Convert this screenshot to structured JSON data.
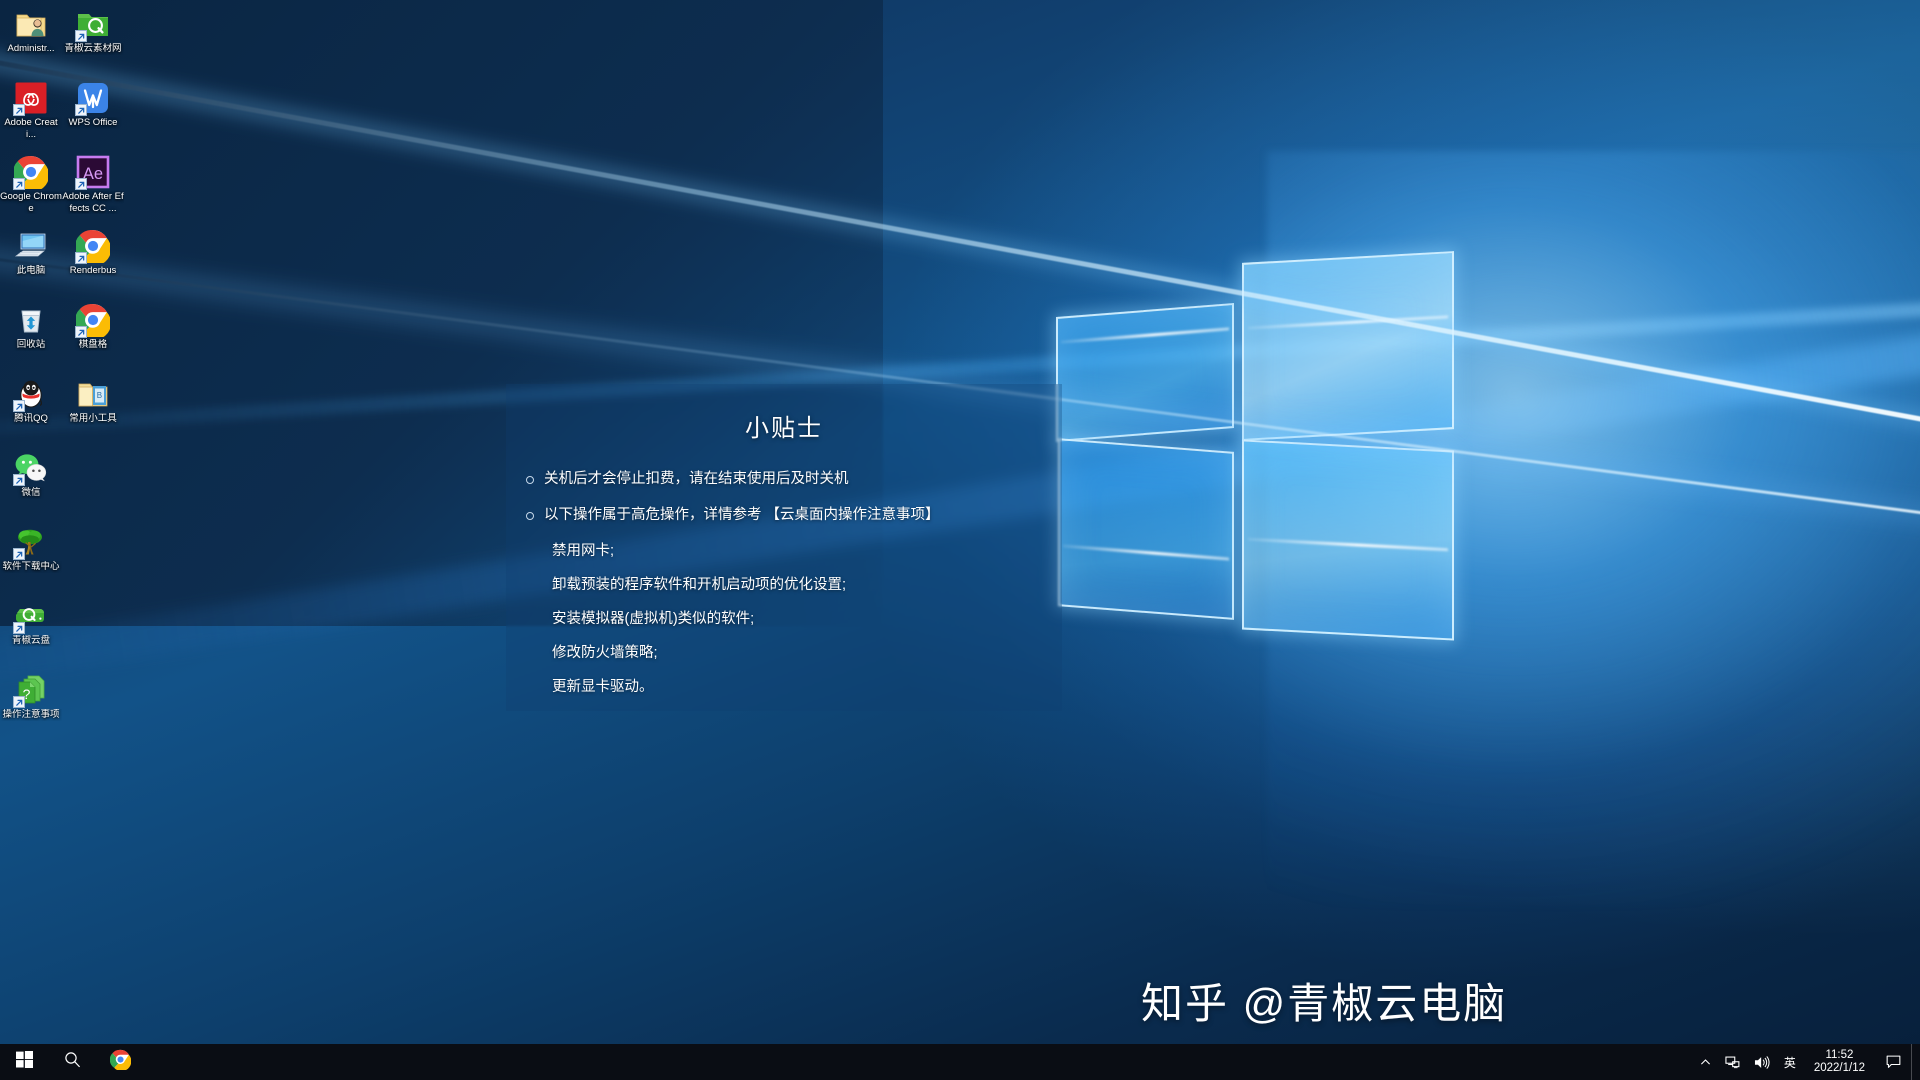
{
  "desktop": {
    "icons": [
      {
        "label": "Administr...",
        "icon": "user-folder-icon",
        "shortcut": false
      },
      {
        "label": "青椒云素材网",
        "icon": "green-folder-q-icon",
        "shortcut": true
      },
      {
        "label": "Adobe Creati...",
        "icon": "adobe-creative-cloud-icon",
        "shortcut": true
      },
      {
        "label": "WPS Office",
        "icon": "wps-office-icon",
        "shortcut": true
      },
      {
        "label": "Google Chrome",
        "icon": "chrome-icon",
        "shortcut": true
      },
      {
        "label": "Adobe After Effects CC ...",
        "icon": "after-effects-icon",
        "shortcut": true
      },
      {
        "label": "此电脑",
        "icon": "this-pc-icon",
        "shortcut": false
      },
      {
        "label": "Renderbus",
        "icon": "chrome-icon",
        "shortcut": true
      },
      {
        "label": "回收站",
        "icon": "recycle-bin-icon",
        "shortcut": false
      },
      {
        "label": "棋盘格",
        "icon": "chrome-icon",
        "shortcut": true
      },
      {
        "label": "腾讯QQ",
        "icon": "tencent-qq-icon",
        "shortcut": true
      },
      {
        "label": "常用小工具",
        "icon": "tools-folder-icon",
        "shortcut": false
      },
      {
        "label": "微信",
        "icon": "wechat-icon",
        "shortcut": true
      },
      {
        "label": "",
        "icon": "empty-slot",
        "shortcut": false
      },
      {
        "label": "软件下载中心",
        "icon": "tree-icon",
        "shortcut": true
      },
      {
        "label": "",
        "icon": "empty-slot",
        "shortcut": false
      },
      {
        "label": "青椒云盘",
        "icon": "green-drive-q-icon",
        "shortcut": true
      },
      {
        "label": "",
        "icon": "empty-slot",
        "shortcut": false
      },
      {
        "label": "操作注意事项",
        "icon": "green-help-doc-icon",
        "shortcut": true
      },
      {
        "label": "",
        "icon": "empty-slot",
        "shortcut": false
      }
    ]
  },
  "tips_panel": {
    "title": "小贴士",
    "bullets": [
      "关机后才会停止扣费，请在结束使用后及时关机",
      "以下操作属于高危操作，详情参考 【云桌面内操作注意事项】"
    ],
    "sub_items": [
      "禁用网卡;",
      "卸载预装的程序软件和开机启动项的优化设置;",
      "安装模拟器(虚拟机)类似的软件;",
      "修改防火墙策略;",
      "更新显卡驱动。"
    ]
  },
  "watermark": {
    "text": "知乎 @青椒云电脑"
  },
  "taskbar": {
    "start_label": "开始",
    "search_label": "搜索",
    "pinned": [
      {
        "label": "Google Chrome",
        "icon": "chrome-icon"
      }
    ],
    "tray": {
      "chevron_label": "显示隐藏的图标",
      "network_label": "网络",
      "volume_label": "音量",
      "ime_label": "英",
      "time": "11:52",
      "date": "2022/1/12",
      "notification_label": "通知"
    }
  },
  "colors": {
    "taskbar_bg": "#0a0d14",
    "wallpaper_base": "#0d3f6c",
    "accent_blue": "#1f8fe0",
    "text_white": "#ffffff",
    "panel_overlay": "rgba(18,62,112,0.30)"
  }
}
